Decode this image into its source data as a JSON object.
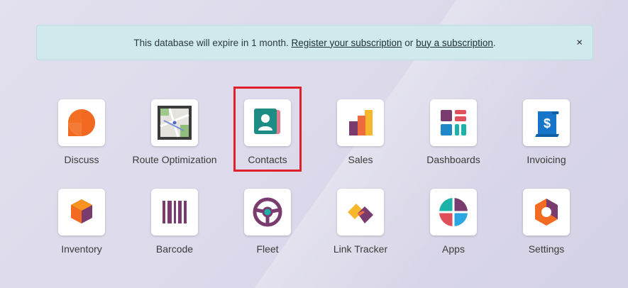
{
  "banner": {
    "prefix": "This database will expire in 1 month. ",
    "register_link": "Register your subscription",
    "middle": " or ",
    "buy_link": "buy a subscription",
    "suffix": ".",
    "close_label": "×"
  },
  "apps": [
    {
      "label": "Discuss",
      "icon": "discuss-icon"
    },
    {
      "label": "Route Optimization",
      "icon": "route-map-icon"
    },
    {
      "label": "Contacts",
      "icon": "contacts-icon"
    },
    {
      "label": "Sales",
      "icon": "sales-icon"
    },
    {
      "label": "Dashboards",
      "icon": "dashboards-icon"
    },
    {
      "label": "Invoicing",
      "icon": "invoicing-icon"
    },
    {
      "label": "Inventory",
      "icon": "inventory-icon"
    },
    {
      "label": "Barcode",
      "icon": "barcode-icon"
    },
    {
      "label": "Fleet",
      "icon": "fleet-icon"
    },
    {
      "label": "Link Tracker",
      "icon": "link-tracker-icon"
    },
    {
      "label": "Apps",
      "icon": "apps-icon"
    },
    {
      "label": "Settings",
      "icon": "settings-icon"
    }
  ],
  "highlight_color": "#e0202a"
}
